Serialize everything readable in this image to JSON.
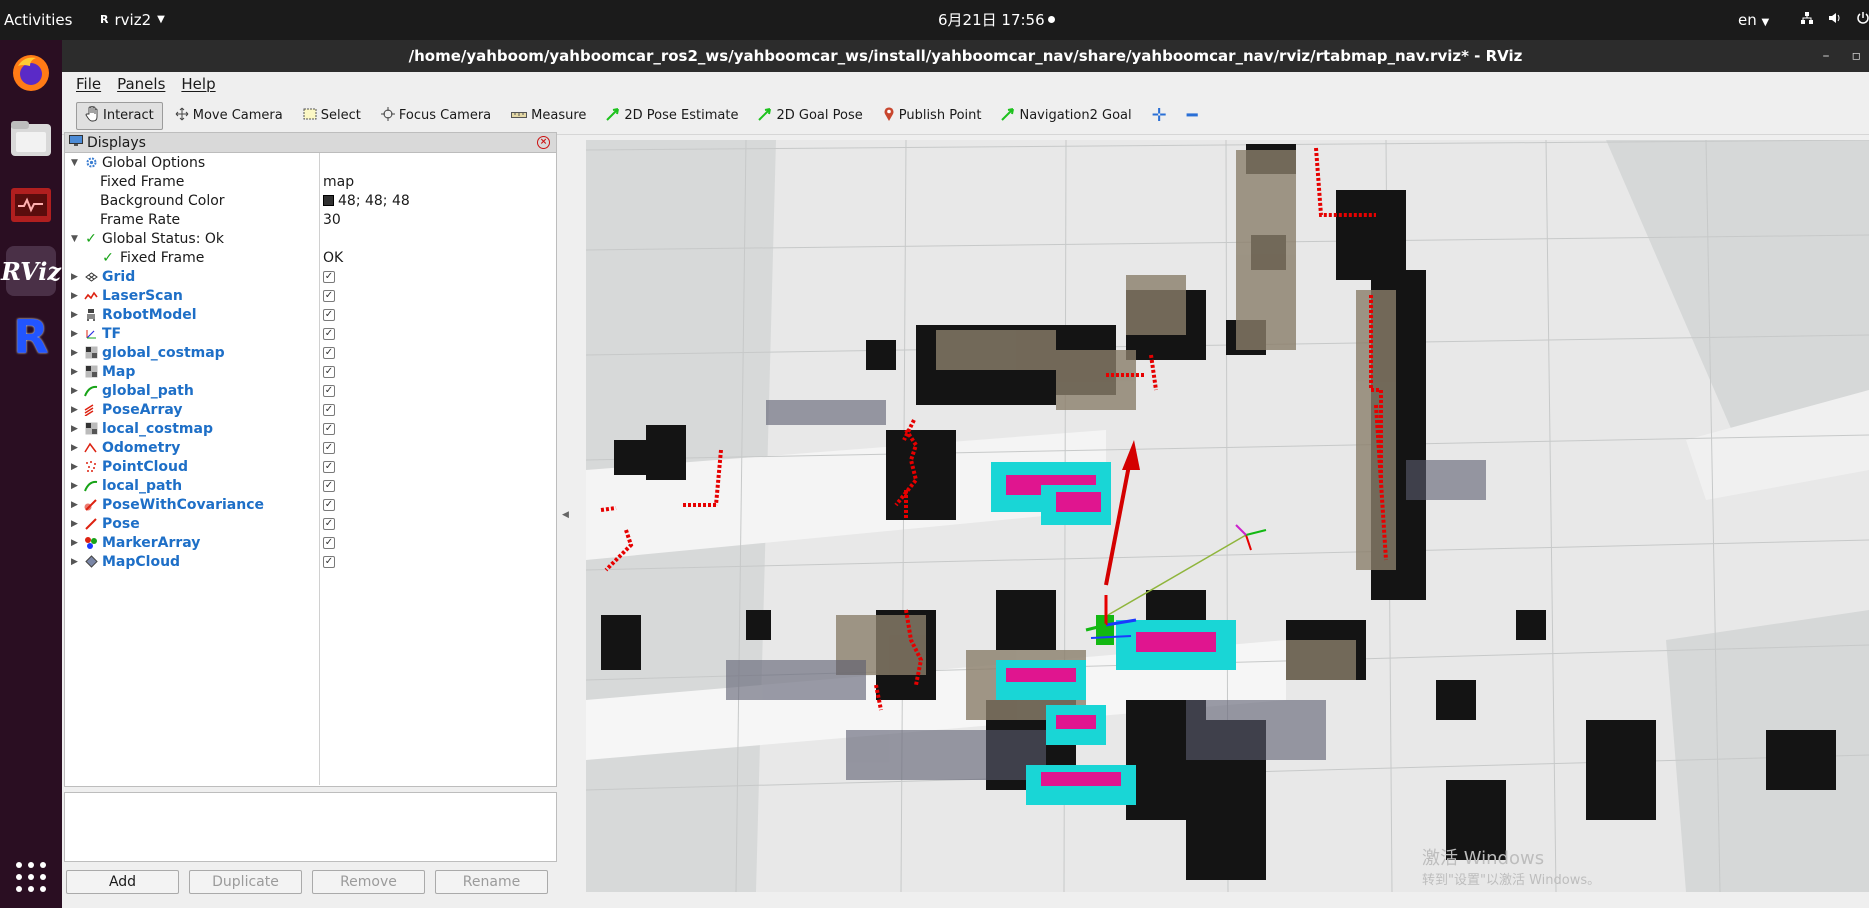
{
  "topbar": {
    "activities": "Activities",
    "app_name": "rviz2",
    "clock": "6月21日  17:56",
    "lang": "en"
  },
  "window": {
    "title": "/home/yahboom/yahboomcar_ros2_ws/yahboomcar_ws/install/yahboomcar_nav/share/yahboomcar_nav/rviz/rtabmap_nav.rviz* - RViz"
  },
  "menubar": [
    "File",
    "Panels",
    "Help"
  ],
  "toolbar": {
    "interact": "Interact",
    "move_camera": "Move Camera",
    "select": "Select",
    "focus_camera": "Focus Camera",
    "measure": "Measure",
    "pose_estimate": "2D Pose Estimate",
    "goal_pose": "2D Goal Pose",
    "publish_point": "Publish Point",
    "nav2_goal": "Navigation2 Goal"
  },
  "displays": {
    "title": "Displays",
    "global_options": "Global Options",
    "fixed_frame_label": "Fixed Frame",
    "fixed_frame_value": "map",
    "background_color_label": "Background Color",
    "background_color_value": "48; 48; 48",
    "background_color_swatch": "#303030",
    "frame_rate_label": "Frame Rate",
    "frame_rate_value": "30",
    "global_status": "Global Status: Ok",
    "status_fixed_frame_label": "Fixed Frame",
    "status_fixed_frame_value": "OK",
    "items": [
      {
        "label": "Grid",
        "icon": "grid-icon",
        "checked": true
      },
      {
        "label": "LaserScan",
        "icon": "laserscan-icon",
        "checked": true
      },
      {
        "label": "RobotModel",
        "icon": "robot-model-icon",
        "checked": true
      },
      {
        "label": "TF",
        "icon": "tf-icon",
        "checked": true
      },
      {
        "label": "global_costmap",
        "icon": "map-icon",
        "checked": true
      },
      {
        "label": "Map",
        "icon": "map-icon",
        "checked": true
      },
      {
        "label": "global_path",
        "icon": "path-icon",
        "checked": true
      },
      {
        "label": "PoseArray",
        "icon": "pose-array-icon",
        "checked": true
      },
      {
        "label": "local_costmap",
        "icon": "map-icon",
        "checked": true
      },
      {
        "label": "Odometry",
        "icon": "odometry-icon",
        "checked": true
      },
      {
        "label": "PointCloud",
        "icon": "pointcloud-icon",
        "checked": true
      },
      {
        "label": "local_path",
        "icon": "path-icon",
        "checked": true
      },
      {
        "label": "PoseWithCovariance",
        "icon": "pose-covariance-icon",
        "checked": true
      },
      {
        "label": "Pose",
        "icon": "pose-icon",
        "checked": true
      },
      {
        "label": "MarkerArray",
        "icon": "marker-array-icon",
        "checked": true
      },
      {
        "label": "MapCloud",
        "icon": "mapcloud-icon",
        "checked": true
      }
    ]
  },
  "buttons": {
    "add": "Add",
    "duplicate": "Duplicate",
    "remove": "Remove",
    "rename": "Rename"
  },
  "watermark": {
    "line1": "激活 Windows",
    "line2": "转到\"设置\"以激活 Windows。"
  },
  "colors": {
    "link_blue": "#1e6fc7",
    "laser_red": "#e60000",
    "costmap_cyan": "#19d6d6",
    "costmap_magenta": "#e0158f",
    "path_green": "#12b812"
  }
}
